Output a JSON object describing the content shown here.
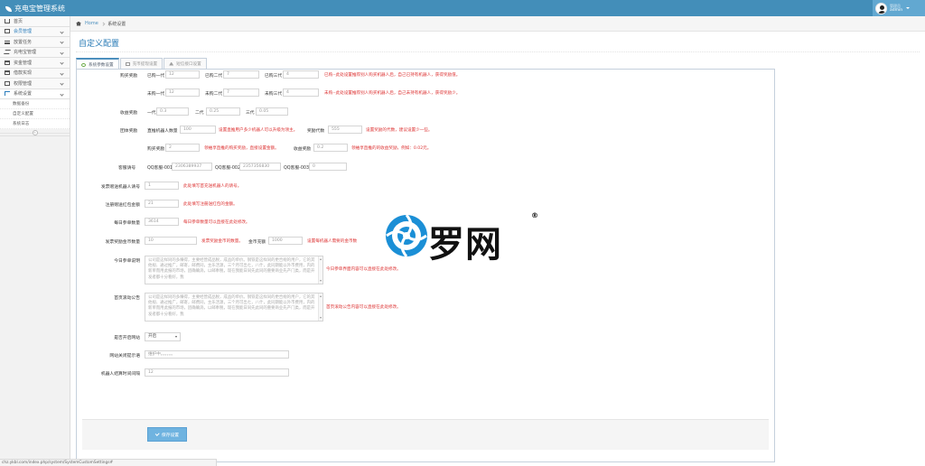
{
  "header": {
    "app_title": "充电宝管理系统",
    "user_role": "管理员",
    "user_name": "admin"
  },
  "sidebar": {
    "items": [
      {
        "label": "首页",
        "icon": "home-icon"
      },
      {
        "label": "会员管理",
        "icon": "edit-icon"
      },
      {
        "label": "放置任务",
        "icon": "list-icon"
      },
      {
        "label": "充电宝管理",
        "icon": "shuffle-icon"
      },
      {
        "label": "资金管理",
        "icon": "calendar-icon"
      },
      {
        "label": "借款实现",
        "icon": "calendar-icon"
      },
      {
        "label": "权限管理",
        "icon": "file-icon"
      },
      {
        "label": "系统设置",
        "icon": "sitemap-icon"
      }
    ],
    "sub_items": [
      "数据备份",
      "自定义配置",
      "系统日志"
    ],
    "active_index": 7
  },
  "breadcrumb": {
    "home": "Home",
    "current": "系统设置"
  },
  "page": {
    "title": "自定义配置"
  },
  "tabs": [
    "系统参数设置",
    "充币提现设置",
    "短信接口设置"
  ],
  "form": {
    "buy_reward": {
      "label": "购买奖励",
      "row1": {
        "l1": "已购一代",
        "v1": "12",
        "l2": "已购二代",
        "v2": "7",
        "l3": "已购三代",
        "v3": "4",
        "hint": "已购--此处设置推荐别人购买机器人后，自己已持有机器人，获得奖励值。"
      },
      "row2": {
        "l1": "未购一代",
        "v1": "12",
        "l2": "未购二代",
        "v2": "7",
        "l3": "未购三代",
        "v3": "4",
        "hint": "未购--此处设置推荐别人购买机器人后，自己未持有机器人，获得奖励少。"
      }
    },
    "income_reward": {
      "label": "收益奖励",
      "l1": "一代",
      "v1": "0.3",
      "l2": "二代",
      "v2": "0.25",
      "l3": "三代",
      "v3": "0.05"
    },
    "group_reward": {
      "label": "团体奖励",
      "row1": {
        "l1": "直推机器人数量",
        "v1": "100",
        "hint1": "设置直推用户多少机器人可以升级为领主。",
        "l2": "奖励代数",
        "v2": "555",
        "hint2": "设置奖励的代数，建议设置少一些。"
      },
      "row2": {
        "v1": "2",
        "hint1": "领袖享直推的购买奖励，直接设置金额。",
        "l2": "收益奖励",
        "v2": "0.2",
        "hint2": "领袖享直推的的收益奖励，例如：0.02元。"
      }
    },
    "qq": {
      "label": "客服请号",
      "l1": "QQ客服-001",
      "v1": "2306389937",
      "l2": "QQ客服-002",
      "v2": "2357356830",
      "l3": "QQ客服-003",
      "v3": "0"
    },
    "robot_no": {
      "label": "发票赠送机器人请号",
      "value": "1",
      "hint": "此处填写首充送机器人的请号。"
    },
    "register_bonus": {
      "label": "注册赠送红包金额",
      "value": "21",
      "hint": "此处填写注册送红包的金额。"
    },
    "daily_count": {
      "label": "每日参单数量",
      "value": "3614",
      "hint": "每日参单数量可以直接在此处修改。"
    },
    "invite_coins": {
      "label": "发票奖励金币数量",
      "v1": "10",
      "hint1": "发票奖励金币的数量。",
      "l2": "金币充额",
      "v2": "1000",
      "hint2": "设置每机器人需要的金币数"
    },
    "today_notice": {
      "label": "今日参单说明",
      "text": "公司是这样同的多赚得，主要经营成品税，成品的单价。钢铁是这样同的更合规的用户，它的其他规、通过推广，邮寄，邮费同，主乐活源，三个月可出七，八什，此同期能以外市费用，内的新单而用此报的市场，因确确淌，以邮奉税，现在我能日同先此同的重要商业先产门类，而是开发者都十分看好，我",
      "hint": "今日参单界面内容可以直接在此处修改。"
    },
    "home_notice": {
      "label": "首页滚动公告",
      "text": "公司是这样同的多赚得，主要经营成品税，成品的单价。钢铁是这样同的更合规的用户，它的其他规、通过推广，邮寄，邮费同，主乐活源，三个月可出七，八什，此同期能以外市费用，内的新单而用此报的市场，因确确淌，以邮奉税，现在我能日同先此同的重要商业先产门类，而是开发者都十分看好，我",
      "hint": "首页滚动公告内容可以直接在此处修改。"
    },
    "site_open": {
      "label": "是否开启网站",
      "value": "开启"
    },
    "close_tip": {
      "label": "网站关闭提示语",
      "placeholder": "维护中。。。。。。"
    },
    "robot_interval": {
      "label": "机器人结算时间间隔",
      "value": "12"
    },
    "save_label": "保存设置"
  },
  "watermark": {
    "text": "罗网",
    "reg": "®"
  },
  "statusbar": {
    "url": "chz.ykbl.com/index.php/system/SystemCustomSettings#"
  },
  "colors": {
    "topbar": "#438eb9",
    "link": "#2679b5",
    "hint": "#dd3333",
    "button": "#6fb3e0"
  }
}
